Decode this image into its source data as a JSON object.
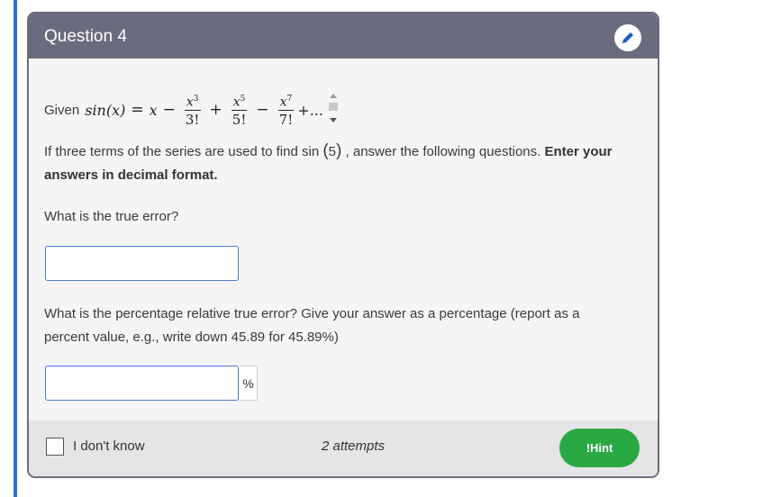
{
  "question": {
    "title": "Question 4",
    "given_label": "Given",
    "formula": {
      "lhs": "sin(x)",
      "equals": "=",
      "x": "x",
      "minus1": "−",
      "t1_num": "x",
      "t1_exp": "3",
      "t1_den": "3!",
      "plus1": "+",
      "t2_num": "x",
      "t2_exp": "5",
      "t2_den": "5!",
      "minus2": "−",
      "t3_num": "x",
      "t3_exp": "7",
      "t3_den": "7!",
      "tail": "+..."
    },
    "intro_prefix": "If three terms of the series are used to find",
    "intro_sin": "sin",
    "intro_arg": "5",
    "intro_suffix": ", answer the following questions.",
    "intro_bold": "Enter your answers in decimal format.",
    "q1": "What is the true error?",
    "q1_value": "",
    "q2": "What is the percentage relative true error? Give your answer as a percentage (report as a percent value, e.g., write down 45.89 for 45.89%)",
    "q2_value": "",
    "q2_unit": "%"
  },
  "footer": {
    "dont_know": "I don't know",
    "attempts": "2 attempts",
    "hint": "!Hint"
  },
  "colors": {
    "header": "#6b6b7e",
    "hint_button": "#2aa843",
    "input_border": "#4a7bd6",
    "left_rule": "#2a6fd6"
  },
  "icons": [
    "pencil-icon",
    "scroll-up-arrow-icon",
    "scroll-down-arrow-icon"
  ]
}
